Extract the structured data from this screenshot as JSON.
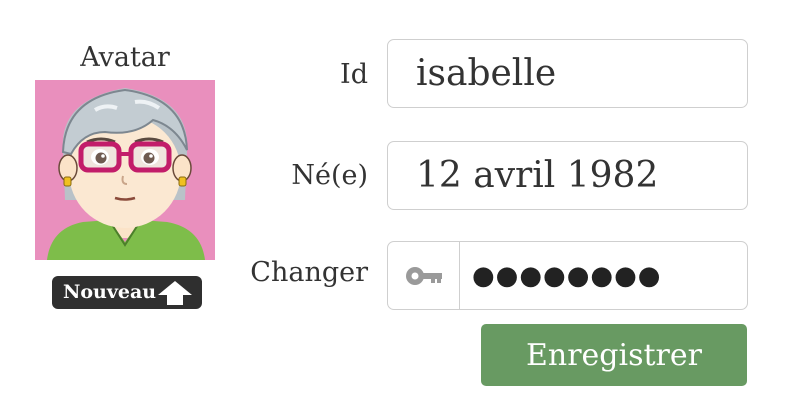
{
  "avatar": {
    "title": "Avatar",
    "background_color": "#e98fbd",
    "image_icon": "cartoon-woman-avatar",
    "new_button_label": "Nouveau",
    "new_button_icon": "upload-arrow-icon"
  },
  "form": {
    "id_label": "Id",
    "id_value": "isabelle",
    "birth_label": "Né(e)",
    "birth_value": "12 avril 1982",
    "password_label": "Changer",
    "password_icon": "key-icon",
    "password_value": "●●●●●●●●",
    "save_label": "Enregistrer"
  },
  "colors": {
    "save_button": "#689a62",
    "new_button": "#2f2f2f",
    "border": "#cfcfcf"
  }
}
